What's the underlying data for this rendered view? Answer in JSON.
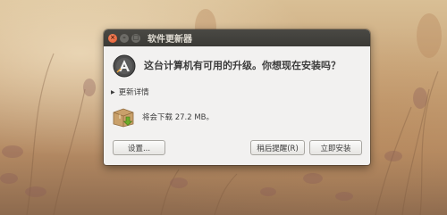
{
  "window": {
    "title": "软件更新器"
  },
  "dialog": {
    "headline": "这台计算机有可用的升级。你想现在安装吗？",
    "details_label": "更新详情",
    "download_text": "将会下载 27.2 MB。"
  },
  "buttons": {
    "settings": "设置...",
    "remind_later": "稍后提醒(R)",
    "install_now": "立即安装"
  },
  "icons": {
    "app": "software-updater-icon",
    "package": "package-download-icon",
    "close": "close-icon",
    "minimize": "minimize-icon",
    "maximize": "maximize-icon",
    "expander": "disclosure-triangle-icon"
  },
  "colors": {
    "titlebar": "#3b3a36",
    "close_button": "#e4572e",
    "dialog_bg": "#f2f1f0",
    "text": "#3c3c3c"
  }
}
